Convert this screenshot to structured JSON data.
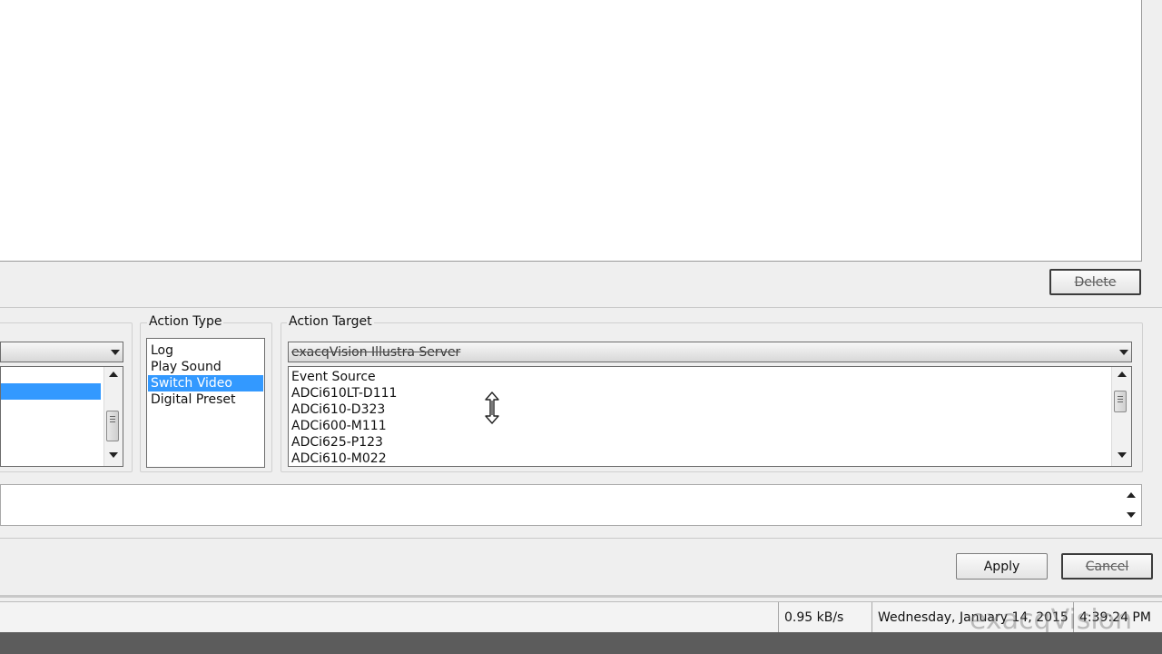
{
  "buttons": {
    "delete": "Delete",
    "apply": "Apply",
    "cancel": "Cancel"
  },
  "action_type": {
    "title": "Action Type",
    "items": [
      {
        "label": "Log",
        "selected": false
      },
      {
        "label": "Play Sound",
        "selected": false
      },
      {
        "label": "Switch Video",
        "selected": true
      },
      {
        "label": "Digital Preset",
        "selected": false
      }
    ]
  },
  "action_target": {
    "title": "Action Target",
    "combo_value": "exacqVision Illustra Server",
    "items": [
      "Event Source",
      "ADCi610LT-D111",
      "ADCi610-D323",
      "ADCi600-M111",
      "ADCi625-P123",
      "ADCi610-M022"
    ]
  },
  "status": {
    "rate": "0.95 kB/s",
    "datetime": "Wednesday, January 14, 2015",
    "time": "4:39:24 PM"
  },
  "watermark": "exacqVision",
  "colors": {
    "selection": "#3399ff",
    "panel": "#ffffff",
    "background": "#efefef"
  }
}
